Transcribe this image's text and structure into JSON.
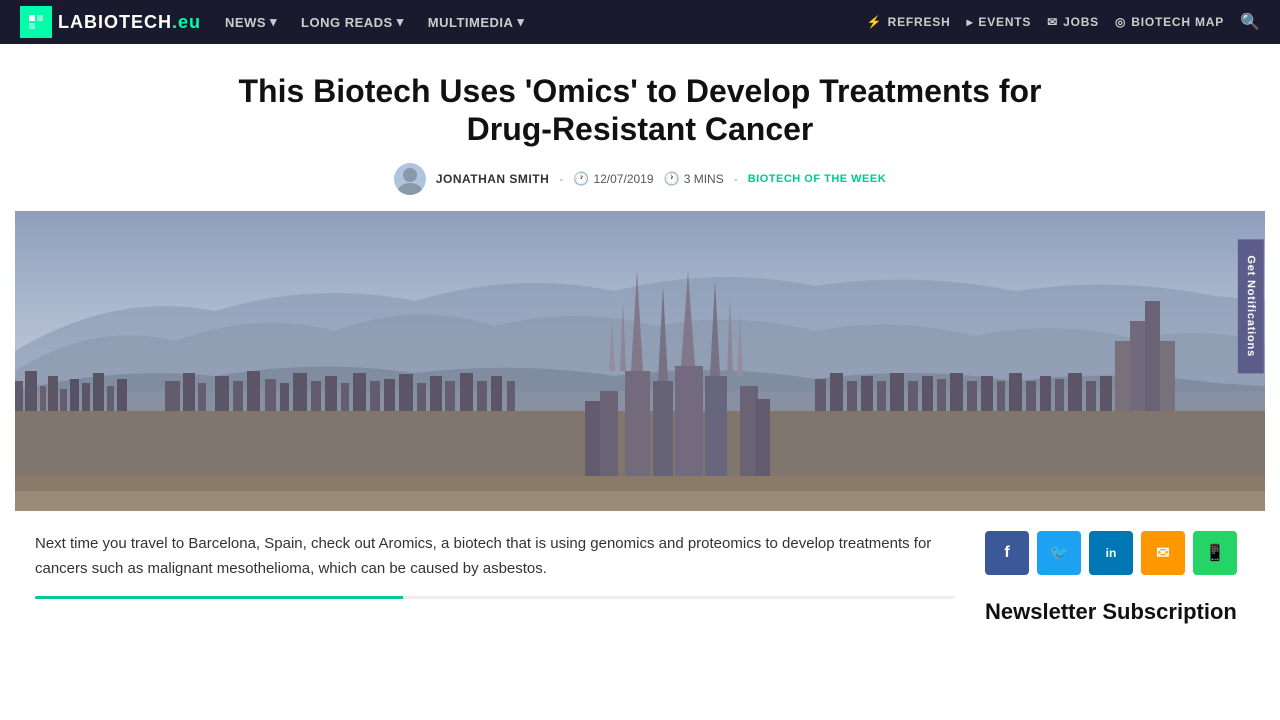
{
  "nav": {
    "logo_text": "LABIOTECH",
    "logo_suffix": ".eu",
    "items": [
      {
        "label": "NEWS",
        "has_dropdown": true
      },
      {
        "label": "LONG READS",
        "has_dropdown": true
      },
      {
        "label": "MULTIMEDIA",
        "has_dropdown": true
      }
    ],
    "right_items": [
      {
        "label": "REFRESH",
        "icon": "⚡"
      },
      {
        "label": "EVENTS",
        "icon": "▸"
      },
      {
        "label": "JOBS",
        "icon": "✉"
      },
      {
        "label": "BIOTECH MAP",
        "icon": "◎"
      }
    ],
    "search_icon": "🔍"
  },
  "article": {
    "title": "This Biotech Uses 'Omics' to Develop Treatments for Drug-Resistant Cancer",
    "author": "JONATHAN SMITH",
    "date": "12/07/2019",
    "read_time": "3 MINS",
    "category": "BIOTECH OF THE WEEK",
    "excerpt": "Next time you travel to Barcelona, Spain, check out Aromics, a biotech that is using genomics and proteomics to develop treatments for cancers such as malignant mesothelioma, which can be caused by asbestos."
  },
  "sidebar": {
    "newsletter_title": "Newsletter Subscription",
    "social_buttons": [
      {
        "platform": "facebook",
        "icon": "f",
        "color": "#3b5998"
      },
      {
        "platform": "twitter",
        "icon": "t",
        "color": "#1da1f2"
      },
      {
        "platform": "linkedin",
        "icon": "in",
        "color": "#0077b5"
      },
      {
        "platform": "email",
        "icon": "✉",
        "color": "#ff9800"
      },
      {
        "platform": "whatsapp",
        "icon": "W",
        "color": "#25d366"
      }
    ]
  },
  "notifications_btn": "Get Notifications"
}
